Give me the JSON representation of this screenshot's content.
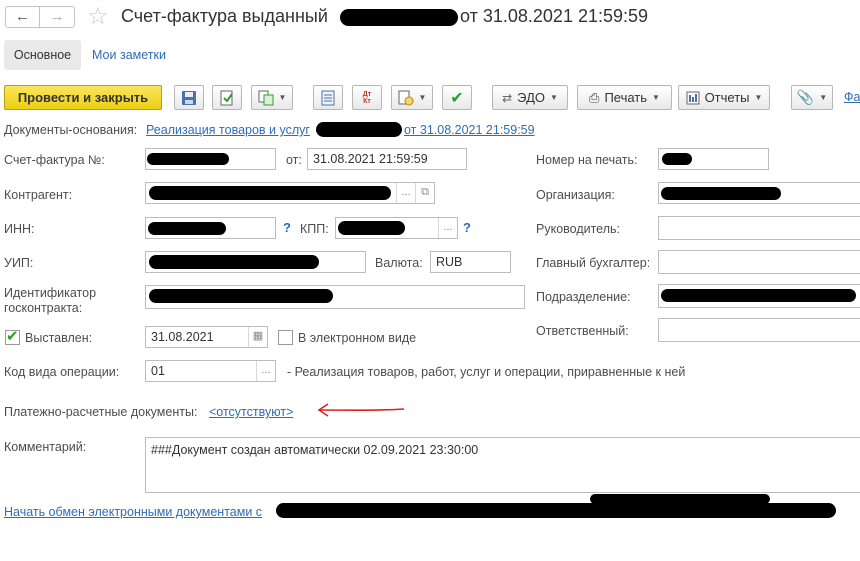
{
  "header": {
    "title_prefix": "Счет-фактура выданный",
    "title_suffix": "от 31.08.2021 21:59:59"
  },
  "tabs": [
    {
      "label": "Основное"
    },
    {
      "label": "Мои заметки"
    }
  ],
  "toolbar": {
    "post_close_label": "Провести и закрыть",
    "edo_label": "ЭДО",
    "print_label": "Печать",
    "reports_label": "Отчеты",
    "dt_kt_label": "Дт Кт",
    "extra_label": "Фа"
  },
  "base_docs": {
    "label": "Документы-основания:",
    "link_text": "Реализация товаров и услуг",
    "link_suffix": "от 31.08.2021 21:59:59"
  },
  "form": {
    "invoice_no_label": "Счет-фактура №:",
    "date_label": "от:",
    "date_value": "31.08.2021 21:59:59",
    "counterparty_label": "Контрагент:",
    "inn_label": "ИНН:",
    "kpp_label": "КПП:",
    "uip_label": "УИП:",
    "currency_label": "Валюта:",
    "currency_value": "RUB",
    "contract_id_label": "Идентификатор госконтракта:",
    "issued_label": "Выставлен:",
    "issued_date": "31.08.2021",
    "electronic_label": "В электронном виде",
    "op_code_label": "Код вида операции:",
    "op_code_value": "01",
    "op_code_desc": "- Реализация товаров, работ, услуг и операции, приравненные к ней",
    "payment_docs_label": "Платежно-расчетные документы:",
    "payment_docs_link": "<отсутствуют>",
    "comment_label": "Комментарий:",
    "comment_value": "###Документ создан автоматически 02.09.2021 23:30:00"
  },
  "right_col": {
    "print_no_label": "Номер на печать:",
    "org_label": "Организация:",
    "head_label": "Руководитель:",
    "chief_acc_label": "Главный бухгалтер:",
    "dept_label": "Подразделение:",
    "responsible_label": "Ответственный:"
  },
  "footer": {
    "edo_link": "Начать обмен электронными документами с"
  },
  "colors": {
    "accent_yellow": "#f5dc2a",
    "link_blue": "#2f6cb5",
    "annotation_red": "#e02020",
    "check_green": "#2aa02a"
  }
}
